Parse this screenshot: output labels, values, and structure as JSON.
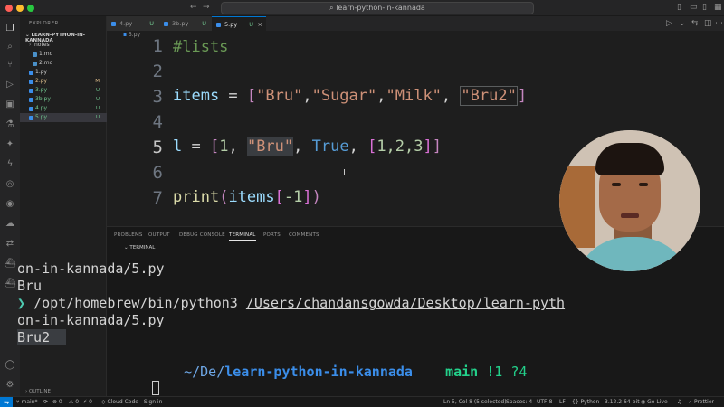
{
  "window": {
    "command_center": "learn-python-in-kannada"
  },
  "sidebar": {
    "title": "EXPLORER",
    "root": "LEARN-PYTHON-IN-KANNADA",
    "items": [
      {
        "label": "notes",
        "badge": ""
      },
      {
        "label": "1.md",
        "badge": ""
      },
      {
        "label": "2.md",
        "badge": ""
      },
      {
        "label": "1.py",
        "badge": ""
      },
      {
        "label": "2.py",
        "badge": "M"
      },
      {
        "label": "3.py",
        "badge": "U"
      },
      {
        "label": "3b.py",
        "badge": "U"
      },
      {
        "label": "4.py",
        "badge": "U"
      },
      {
        "label": "5.py",
        "badge": "U"
      }
    ],
    "outline": "OUTLINE"
  },
  "tabs": [
    {
      "label": "4.py",
      "badge": "U"
    },
    {
      "label": "3b.py",
      "badge": "U"
    },
    {
      "label": "5.py",
      "badge": "U"
    }
  ],
  "breadcrumb": "5.py",
  "editor": {
    "lines": [
      {
        "num": "1",
        "text": "#lists"
      },
      {
        "num": "2",
        "text": ""
      },
      {
        "num": "3",
        "text": "items = [\"Bru\",\"Sugar\",\"Milk\", \"Bru2\"]"
      },
      {
        "num": "4",
        "text": ""
      },
      {
        "num": "5",
        "text": "l = [1, \"Bru\", True, [1,2,3]]"
      },
      {
        "num": "6",
        "text": ""
      },
      {
        "num": "7",
        "text": "print(items[-1])"
      }
    ],
    "tokens": {
      "comment": "#lists",
      "items": "items",
      "eq": " = ",
      "ob": "[",
      "s1": "\"Bru\"",
      "c1": ",",
      "s2": "\"Sugar\"",
      "c2": ",",
      "s3": "\"Milk\"",
      "c3": ", ",
      "s4": "\"Bru2\"",
      "cb": "]",
      "l": "l",
      "eq2": " = ",
      "ob2": "[",
      "n1": "1",
      "c4": ", ",
      "s5": "\"Bru\"",
      "c5": ", ",
      "kw": "True",
      "c6": ", ",
      "ob3": "[",
      "n2": "1,2,3",
      "cb3": "]",
      "cb2": "]",
      "fn": "print",
      "op": "(",
      "items2": "items",
      "ob4": "[",
      "n3": "-1",
      "cb4": "]",
      "cp": ")"
    }
  },
  "panel": {
    "tabs": [
      "PROBLEMS",
      "OUTPUT",
      "DEBUG CONSOLE",
      "TERMINAL",
      "PORTS",
      "COMMENTS"
    ],
    "terminal_label": "TERMINAL",
    "lines": {
      "l1": "on-in-kannada/5.py",
      "l2": "Bru",
      "prompt": "❯",
      "cmd": "/opt/homebrew/bin/python3",
      "path": "/Users/chandansgowda/Desktop/learn-pyth",
      "l4": "on-in-kannada/5.py",
      "l5": "Bru2",
      "p_apple": "",
      "p_sep1": "",
      "p_home": "",
      "p_tilde": "~/De/",
      "p_dir": "learn-python-in-kannada",
      "p_sep2": "",
      "p_git": "",
      "p_branch_icon": "",
      "p_branch": "main",
      "p_status": "!1 ?4"
    }
  },
  "statusbar": {
    "branch": "main*",
    "errors": "⊗ 0",
    "warnings": "⚠ 0",
    "ports": "⚡ 0",
    "cloud": "Cloud Code - Sign in",
    "position": "Ln 5, Col 8 (5 selected)",
    "spaces": "Spaces: 4",
    "encoding": "UTF-8",
    "eol": "LF",
    "language": "Python",
    "interpreter": "3.12.2 64-bit",
    "golive": "Go Live",
    "prettier": "Prettier"
  }
}
